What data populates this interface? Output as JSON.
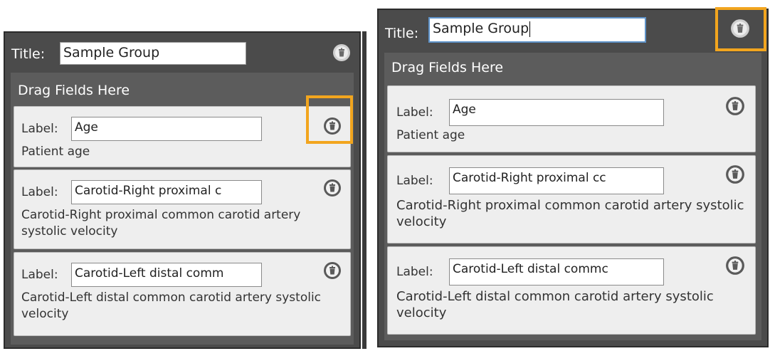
{
  "colors": {
    "panel_bg": "#4b4b4b",
    "card_bg": "#eeeeee",
    "highlight": "#f2a51e",
    "focus_border": "#5f93c9"
  },
  "left_panel": {
    "title_label": "Title:",
    "title_value": "Sample Group",
    "drop_label": "Drag Fields Here",
    "fields": [
      {
        "label_text": "Label:",
        "label_value": "Age",
        "description": "Patient age"
      },
      {
        "label_text": "Label:",
        "label_value": "Carotid-Right proximal c",
        "description": "Carotid-Right proximal common carotid artery systolic velocity"
      },
      {
        "label_text": "Label:",
        "label_value": "Carotid-Left distal comm",
        "description": "Carotid-Left distal common carotid artery systolic velocity"
      }
    ]
  },
  "right_panel": {
    "title_label": "Title:",
    "title_value": "Sample Group",
    "drop_label": "Drag Fields Here",
    "fields": [
      {
        "label_text": "Label:",
        "label_value": "Age",
        "description": "Patient age"
      },
      {
        "label_text": "Label:",
        "label_value": "Carotid-Right proximal cc",
        "description": "Carotid-Right proximal common carotid artery systolic velocity"
      },
      {
        "label_text": "Label:",
        "label_value": "Carotid-Left distal commc",
        "description": "Carotid-Left distal common carotid artery systolic velocity"
      }
    ]
  },
  "icons": {
    "delete": "trash-icon"
  }
}
